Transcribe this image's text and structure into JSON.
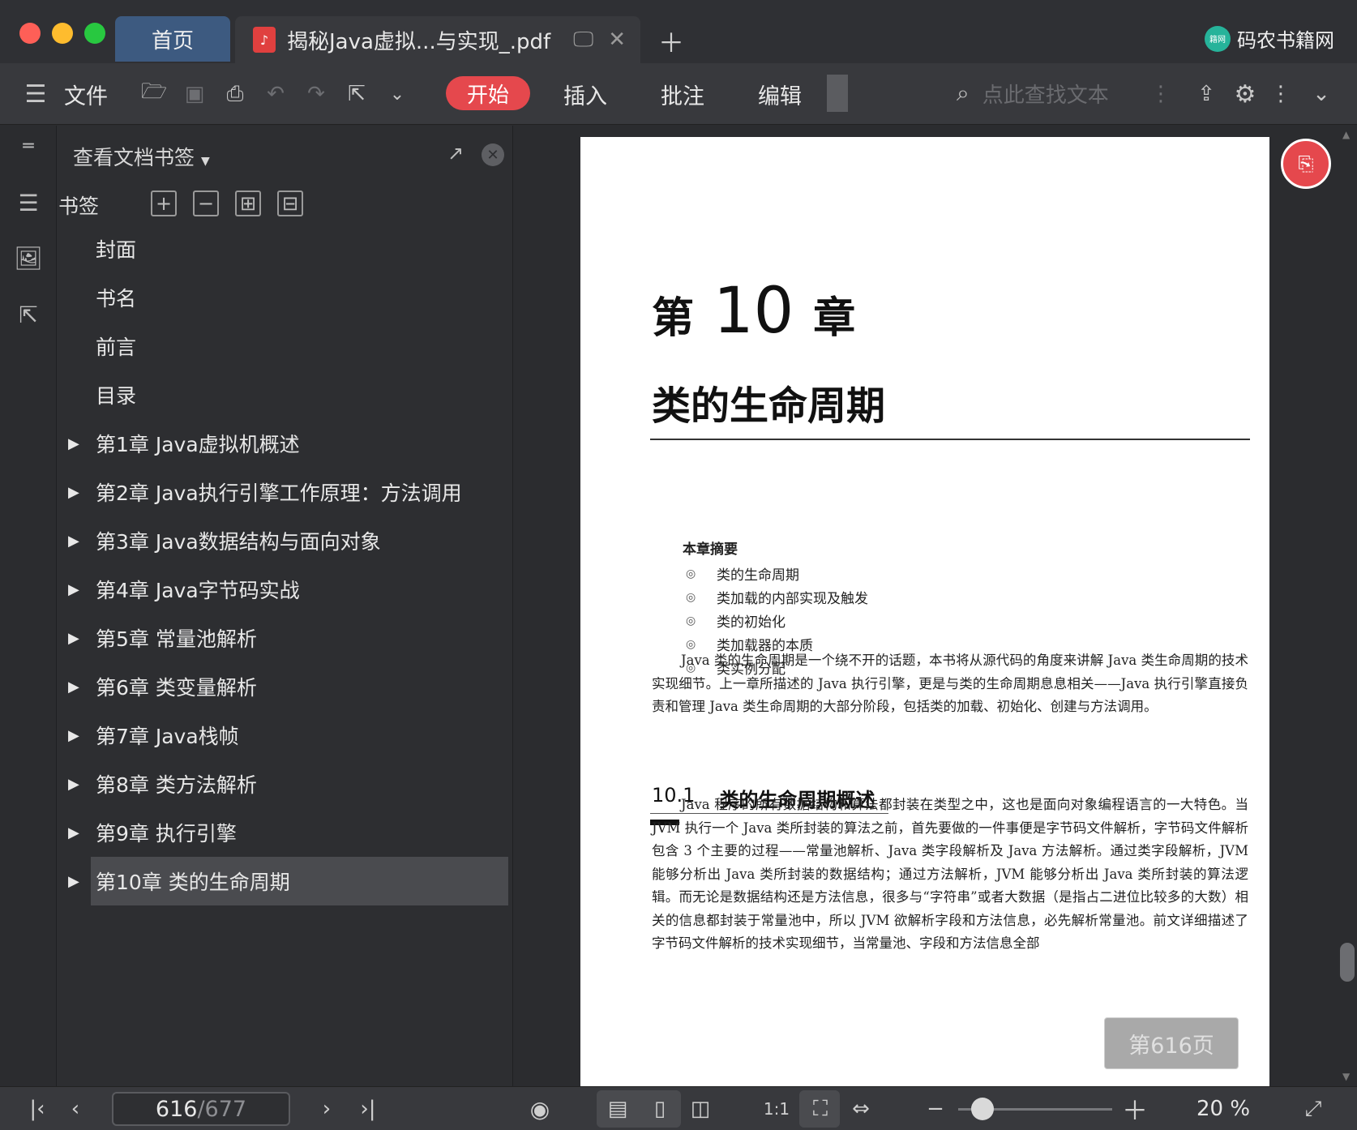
{
  "tabs": {
    "home_label": "首页",
    "doc_label": "揭秘Java虚拟...与实现_.pdf"
  },
  "brand": {
    "name": "码农书籍网",
    "logo_text": "籍网"
  },
  "toolbar": {
    "file_label": "文件",
    "start_label": "开始",
    "insert_label": "插入",
    "annotate_label": "批注",
    "edit_label": "编辑",
    "search_placeholder": "点此查找文本"
  },
  "panel": {
    "header": "查看文档书签",
    "bookmarks_label": "书签",
    "items": [
      {
        "label": "封面",
        "expandable": false
      },
      {
        "label": "书名",
        "expandable": false
      },
      {
        "label": "前言",
        "expandable": false
      },
      {
        "label": "目录",
        "expandable": false
      },
      {
        "label": "第1章 Java虚拟机概述",
        "expandable": true
      },
      {
        "label": "第2章 Java执行引擎工作原理：方法调用",
        "expandable": true
      },
      {
        "label": "第3章 Java数据结构与面向对象",
        "expandable": true
      },
      {
        "label": "第4章 Java字节码实战",
        "expandable": true
      },
      {
        "label": "第5章 常量池解析",
        "expandable": true
      },
      {
        "label": "第6章 类变量解析",
        "expandable": true
      },
      {
        "label": "第7章 Java栈帧",
        "expandable": true
      },
      {
        "label": "第8章 类方法解析",
        "expandable": true
      },
      {
        "label": "第9章 执行引擎",
        "expandable": true
      },
      {
        "label": "第10章 类的生命周期",
        "expandable": true,
        "active": true
      }
    ]
  },
  "document": {
    "chapter_prefix": "第",
    "chapter_number": "10",
    "chapter_suffix": "章",
    "chapter_title": "类的生命周期",
    "summary_title": "本章摘要",
    "summary_items": [
      "类的生命周期",
      "类加载的内部实现及触发",
      "类的初始化",
      "类加载器的本质",
      "类实例分配"
    ],
    "bullet": "◎",
    "intro_paragraph": "Java 类的生命周期是一个绕不开的话题，本书将从源代码的角度来讲解 Java 类生命周期的技术实现细节。上一章所描述的 Java 执行引擎，更是与类的生命周期息息相关——Java 执行引擎直接负责和管理 Java 类生命周期的大部分阶段，包括类的加载、初始化、创建与方法调用。",
    "section_number": "10.1",
    "section_title": "类的生命周期概述",
    "section_paragraph": "Java 程序的所有数据结构和算法都封装在类型之中，这也是面向对象编程语言的一大特色。当 JVM 执行一个 Java 类所封装的算法之前，首先要做的一件事便是字节码文件解析，字节码文件解析包含 3 个主要的过程——常量池解析、Java 类字段解析及 Java 方法解析。通过类字段解析，JVM 能够分析出 Java 类所封装的数据结构；通过方法解析，JVM 能够分析出 Java 类所封装的算法逻辑。而无论是数据结构还是方法信息，很多与“字符串”或者大数据（是指占二进位比较多的大数）相关的信息都封装于常量池中，所以 JVM 欲解析字段和方法信息，必先解析常量池。前文详细描述了字节码文件解析的技术实现细节，当常量池、字段和方法信息全部",
    "page_badge": "第616页"
  },
  "status": {
    "current_page": "616",
    "separator": "/",
    "total_pages": "677",
    "zoom": "20 %",
    "zoom_fraction": 0.2
  },
  "colors": {
    "accent": "#e5484d",
    "home_tab": "#3d5a80",
    "brand_logo": "#26b39a"
  }
}
